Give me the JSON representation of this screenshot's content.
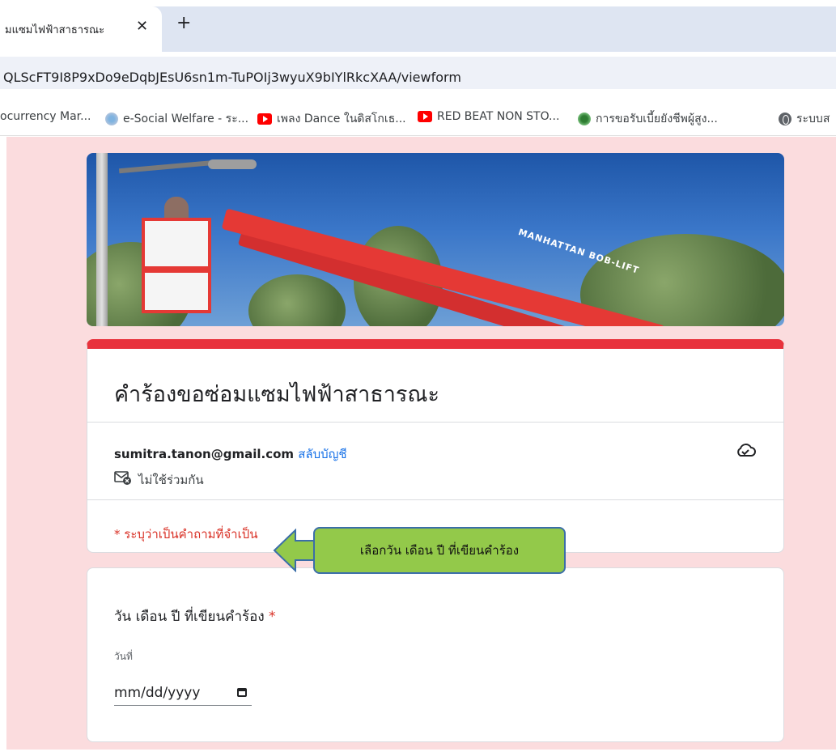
{
  "browser": {
    "tab_title": "มแซมไฟฟ้าสาธารณะ",
    "close_glyph": "✕",
    "new_tab_glyph": "+",
    "url": "QLScFT9I8P9xDo9eDqbJEsU6sn1m-TuPOIj3wyuX9bIYlRkcXAA/viewform",
    "bookmarks": [
      {
        "label": "ocurrency Mar...",
        "icon": "none"
      },
      {
        "label": "e-Social Welfare - ระ...",
        "icon": "gov-icon"
      },
      {
        "label": "เพลง Dance ในดิสโกเธ...",
        "icon": "youtube-icon"
      },
      {
        "label": "RED BEAT NON STO...",
        "icon": "youtube-icon"
      },
      {
        "label": "การขอรับเบี้ยยังชีพผู้สูง...",
        "icon": "seal-icon"
      },
      {
        "label": "ระบบส",
        "icon": "globe-icon"
      }
    ]
  },
  "form": {
    "banner_text": "MANHATTAN BOB-LIFT",
    "title": "คำร้องขอซ่อมแซมไฟฟ้าสาธารณะ",
    "email": "sumitra.tanon@gmail.com",
    "switch_account": "สลับบัญชี",
    "not_shared": "ไม่ใช้ร่วมกัน",
    "required_note": "* ระบุว่าเป็นคำถามที่จำเป็น",
    "question": {
      "title": "วัน เดือน ปี ที่เขียนคำร้อง",
      "required_star": "*",
      "sub_label": "วันที่",
      "date_placeholder": "mm/dd/yyyy"
    }
  },
  "callout": {
    "text": "เลือกวัน เดือน ปี ที่เขียนคำร้อง"
  },
  "colors": {
    "page_bg": "#fbdcde",
    "accent": "#e8323c",
    "link": "#1a73e8",
    "required": "#d93025",
    "callout_fill": "#93c94a",
    "callout_border": "#3b6ea8"
  }
}
